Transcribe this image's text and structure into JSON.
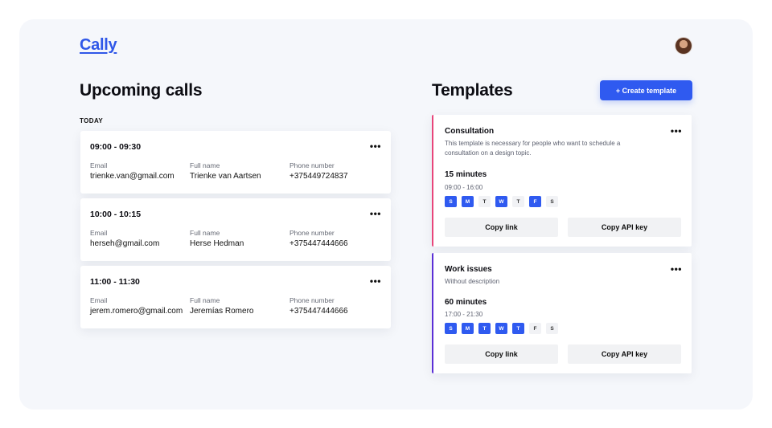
{
  "app": {
    "logo": "Cally"
  },
  "calls": {
    "title": "Upcoming calls",
    "group_label": "TODAY",
    "labels": {
      "email": "Email",
      "full_name": "Full name",
      "phone": "Phone number"
    },
    "items": [
      {
        "time": "09:00 - 09:30",
        "email": "trienke.van@gmail.com",
        "full_name": "Trienke van Aartsen",
        "phone": "+375449724837"
      },
      {
        "time": "10:00 - 10:15",
        "email": "herseh@gmail.com",
        "full_name": "Herse Hedman",
        "phone": "+375447444666"
      },
      {
        "time": "11:00 - 11:30",
        "email": "jerem.romero@gmail.com",
        "full_name": "Jeremías Romero",
        "phone": "+375447444666"
      }
    ]
  },
  "templates": {
    "title": "Templates",
    "create_label": "+ Create template",
    "copy_link_label": "Copy link",
    "copy_api_label": "Copy API key",
    "more_glyph": "•••",
    "items": [
      {
        "title": "Consultation",
        "description": "This template is necessary for people who want to schedule a consultation on a design topic.",
        "duration": "15 minutes",
        "range": "09:00 - 16:00",
        "accent": "#e8457a",
        "days": [
          {
            "d": "S",
            "on": true
          },
          {
            "d": "M",
            "on": true
          },
          {
            "d": "T",
            "on": false
          },
          {
            "d": "W",
            "on": true
          },
          {
            "d": "T",
            "on": false
          },
          {
            "d": "F",
            "on": true
          },
          {
            "d": "S",
            "on": false
          }
        ]
      },
      {
        "title": "Work issues",
        "description": "Without description",
        "duration": "60 minutes",
        "range": "17:00 - 21:30",
        "accent": "#5b2fd6",
        "days": [
          {
            "d": "S",
            "on": true
          },
          {
            "d": "M",
            "on": true
          },
          {
            "d": "T",
            "on": true
          },
          {
            "d": "W",
            "on": true
          },
          {
            "d": "T",
            "on": true
          },
          {
            "d": "F",
            "on": false
          },
          {
            "d": "S",
            "on": false
          }
        ]
      }
    ]
  },
  "colors": {
    "accent_blue": "#2f5af0",
    "panel_bg": "#f5f7fb"
  }
}
